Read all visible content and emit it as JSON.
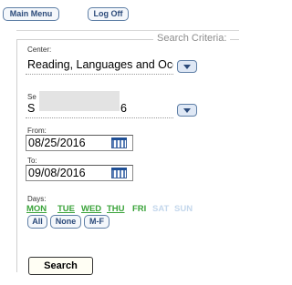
{
  "nav": {
    "main_menu": "Main Menu",
    "log_off": "Log Off"
  },
  "form": {
    "legend": "Search Criteria:",
    "center": {
      "label": "Center:",
      "value": "Reading, Languages and Occ"
    },
    "second": {
      "label": "Se",
      "value_prefix": "S",
      "value_suffix": "6"
    },
    "from": {
      "label": "From:",
      "value": "08/25/2016"
    },
    "to": {
      "label": "To:",
      "value": "09/08/2016"
    },
    "days": {
      "label": "Days:",
      "items": [
        {
          "label": "MON"
        },
        {
          "label": "TUE"
        },
        {
          "label": "WED"
        },
        {
          "label": "THU"
        },
        {
          "label": "FRI"
        },
        {
          "label": "SAT"
        },
        {
          "label": "SUN"
        }
      ],
      "buttons": {
        "all": "All",
        "none": "None",
        "mf": "M-F"
      }
    },
    "search_label": "Search"
  },
  "colors": {
    "selected_day": "#3aa33a",
    "unselected_day": "#c4d7ec",
    "accent": "#2b4a7a"
  },
  "icons": {
    "dropdown": "chevron-down-icon",
    "calendar": "calendar-icon"
  }
}
